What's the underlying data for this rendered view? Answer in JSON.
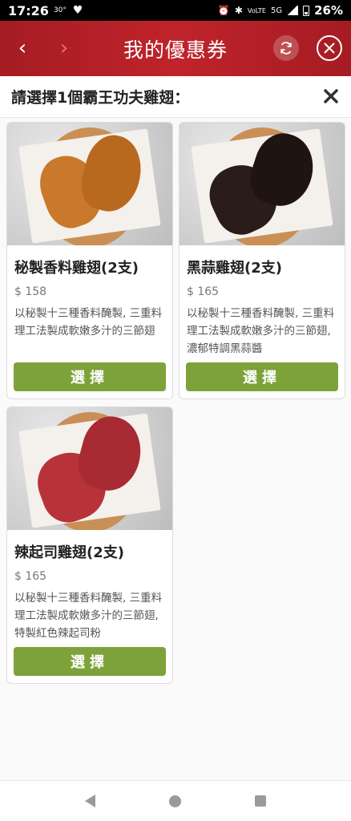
{
  "statusbar": {
    "time": "17:26",
    "temp": "30°",
    "net": "5G",
    "volte": "VoLTE",
    "battery": "26%"
  },
  "header": {
    "title": "我的優惠券",
    "back_icon": "chevron-left-icon",
    "forward_icon": "chevron-right-icon",
    "refresh_icon": "refresh-icon",
    "close_icon": "close-circle-icon",
    "bg_color": "#b9202a"
  },
  "prompt": {
    "text": "請選擇1個霸王功夫雞翅：",
    "close_icon": "close-icon"
  },
  "products": [
    {
      "name": "秘製香料雞翅(2支)",
      "price": "$ 158",
      "desc": "以秘製十三種香料醃製, 三重料理工法製成軟嫩多汁的三節翅",
      "button": "選擇",
      "wing_color": "#c9782c"
    },
    {
      "name": "黑蒜雞翅(2支)",
      "price": "$ 165",
      "desc": "以秘製十三種香料醃製, 三重料理工法製成軟嫩多汁的三節翅, 濃郁特調黑蒜醬",
      "button": "選擇",
      "wing_color": "#2a1c18"
    },
    {
      "name": "辣起司雞翅(2支)",
      "price": "$ 165",
      "desc": "以秘製十三種香料醃製, 三重料理工法製成軟嫩多汁的三節翅, 特製紅色辣起司粉",
      "button": "選擇",
      "wing_color": "#b8323a"
    }
  ],
  "button_color": "#7ea23a",
  "navbar": {
    "back_icon": "nav-back-icon",
    "home_icon": "nav-home-icon",
    "recents_icon": "nav-recents-icon"
  }
}
